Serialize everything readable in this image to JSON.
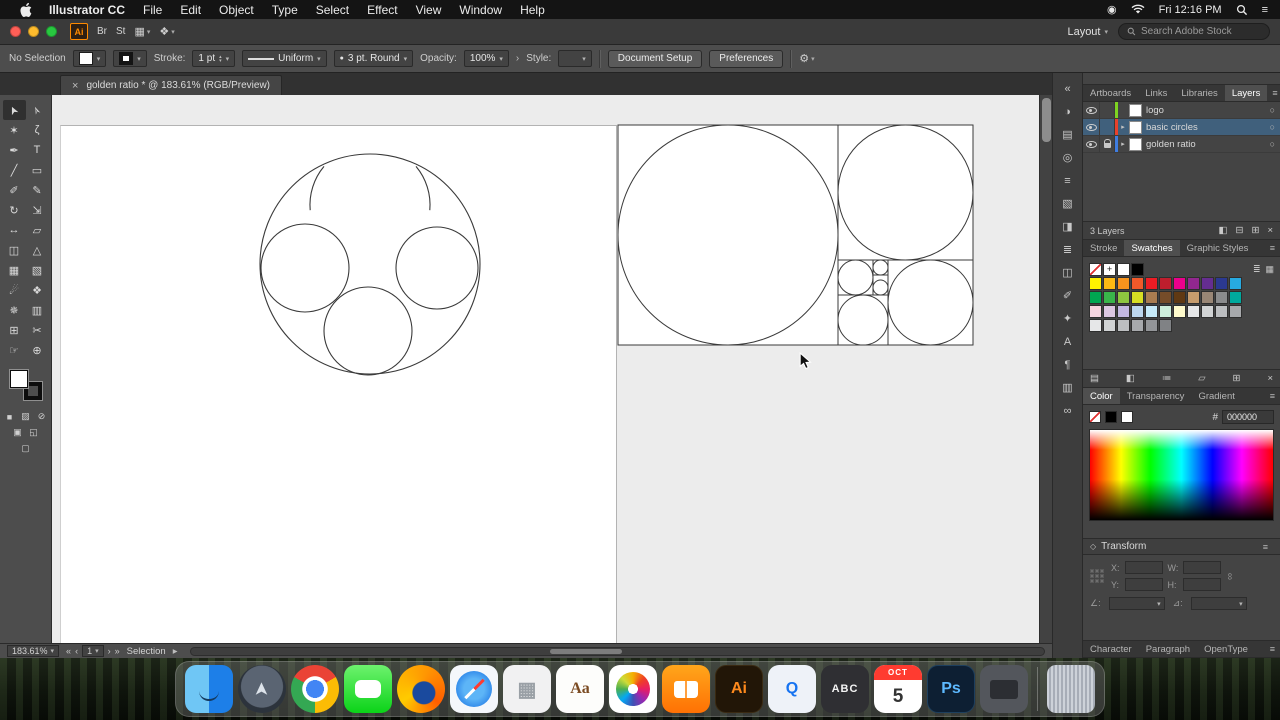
{
  "menubar": {
    "app_name": "Illustrator CC",
    "items": [
      "File",
      "Edit",
      "Object",
      "Type",
      "Select",
      "Effect",
      "View",
      "Window",
      "Help"
    ],
    "clock": "Fri 12:16 PM"
  },
  "appbar": {
    "ai_badge": "Ai",
    "bridge": "Br",
    "stock": "St",
    "layout_label": "Layout",
    "search_placeholder": "Search Adobe Stock"
  },
  "controlbar": {
    "selection_label": "No Selection",
    "stroke_label": "Stroke:",
    "stroke_value": "1 pt",
    "profile_value": "Uniform",
    "brush_value": "3 pt. Round",
    "opacity_label": "Opacity:",
    "opacity_value": "100%",
    "style_label": "Style:",
    "document_setup": "Document Setup",
    "preferences": "Preferences"
  },
  "document_tab": {
    "close": "×",
    "title": "golden ratio * @ 183.61% (RGB/Preview)"
  },
  "tools": [
    {
      "name": "selection-tool",
      "glyph": "➤",
      "active": true
    },
    {
      "name": "direct-selection-tool",
      "glyph": "➢"
    },
    {
      "name": "magic-wand-tool",
      "glyph": "✶"
    },
    {
      "name": "lasso-tool",
      "glyph": "ζ"
    },
    {
      "name": "pen-tool",
      "glyph": "✒"
    },
    {
      "name": "type-tool",
      "glyph": "T"
    },
    {
      "name": "line-segment-tool",
      "glyph": "╱"
    },
    {
      "name": "rectangle-tool",
      "glyph": "▭"
    },
    {
      "name": "paintbrush-tool",
      "glyph": "✐"
    },
    {
      "name": "pencil-tool",
      "glyph": "✎"
    },
    {
      "name": "rotate-tool",
      "glyph": "↻"
    },
    {
      "name": "scale-tool",
      "glyph": "⇲"
    },
    {
      "name": "width-tool",
      "glyph": "↔"
    },
    {
      "name": "free-transform-tool",
      "glyph": "▱"
    },
    {
      "name": "shape-builder-tool",
      "glyph": "◫"
    },
    {
      "name": "perspective-grid-tool",
      "glyph": "△"
    },
    {
      "name": "mesh-tool",
      "glyph": "▦"
    },
    {
      "name": "gradient-tool",
      "glyph": "▧"
    },
    {
      "name": "eyedropper-tool",
      "glyph": "☄"
    },
    {
      "name": "blend-tool",
      "glyph": "❖"
    },
    {
      "name": "symbol-sprayer-tool",
      "glyph": "✵"
    },
    {
      "name": "column-graph-tool",
      "glyph": "▥"
    },
    {
      "name": "artboard-tool",
      "glyph": "⊞"
    },
    {
      "name": "slice-tool",
      "glyph": "✂"
    },
    {
      "name": "hand-tool",
      "glyph": "☞"
    },
    {
      "name": "zoom-tool",
      "glyph": "⊕"
    }
  ],
  "statusbar": {
    "zoom": "183.61%",
    "artboard": "1",
    "status": "Selection"
  },
  "right_strip": {
    "icons": [
      {
        "name": "expand-panels-icon",
        "glyph": "«"
      },
      {
        "name": "color-panel-icon",
        "glyph": "◑"
      },
      {
        "name": "color-guide-panel-icon",
        "glyph": "▤"
      },
      {
        "name": "appearance-panel-icon",
        "glyph": "◎"
      },
      {
        "name": "stroke-panel-icon",
        "glyph": "≡"
      },
      {
        "name": "gradient-panel-icon",
        "glyph": "▧"
      },
      {
        "name": "transparency-panel-icon",
        "glyph": "◨"
      },
      {
        "name": "align-panel-icon",
        "glyph": "≣"
      },
      {
        "name": "pathfinder-panel-icon",
        "glyph": "◫"
      },
      {
        "name": "brushes-panel-icon",
        "glyph": "✐"
      },
      {
        "name": "symbols-panel-icon",
        "glyph": "✦"
      },
      {
        "name": "character-panel-icon",
        "glyph": "A"
      },
      {
        "name": "paragraph-panel-icon",
        "glyph": "¶"
      },
      {
        "name": "libraries-panel-icon",
        "glyph": "▥"
      },
      {
        "name": "links-panel-icon",
        "glyph": "∞"
      }
    ]
  },
  "panels": {
    "top_tabs": [
      "Artboards",
      "Links",
      "Libraries",
      "Layers"
    ],
    "top_active": "Layers",
    "layers": [
      {
        "name": "logo",
        "color": "#7ed321",
        "expander": false,
        "locked": false,
        "selected": false
      },
      {
        "name": "basic circles",
        "color": "#e8412c",
        "expander": true,
        "locked": false,
        "selected": true
      },
      {
        "name": "golden ratio",
        "color": "#3f7de0",
        "expander": true,
        "locked": true,
        "selected": false
      }
    ],
    "layers_count": "3 Layers",
    "layers_icons": [
      {
        "name": "make-clip-mask-icon",
        "glyph": "◧"
      },
      {
        "name": "new-sublayer-icon",
        "glyph": "⊟"
      },
      {
        "name": "new-layer-icon",
        "glyph": "⊞"
      },
      {
        "name": "delete-layer-icon",
        "glyph": "×"
      }
    ],
    "swatch_tabs": [
      "Stroke",
      "Swatches",
      "Graphic Styles"
    ],
    "swatch_active": "Swatches",
    "swatches": {
      "row1": [
        "none",
        "registration",
        "#ffffff",
        "#000000"
      ],
      "rows": [
        [
          "#fff200",
          "#fdb913",
          "#f7941d",
          "#f1592a",
          "#ed1c24",
          "#be1e2d",
          "#ec008c",
          "#92278f",
          "#652d90",
          "#2b3990",
          "#27aae1"
        ],
        [
          "#00a651",
          "#39b54a",
          "#8dc63f",
          "#d7df23",
          "#a97c50",
          "#754c29",
          "#603913",
          "#c69c6d",
          "#998675",
          "#8b8c8d",
          "#00a99d"
        ],
        [
          "#f5d5e0",
          "#dcc7e1",
          "#c3b8e0",
          "#bdd7ee",
          "#c6eaf8",
          "#cdeedb",
          "#fffbcc",
          "#e6e7e8",
          "#d1d3d4",
          "#bcbec0",
          "#a7a9ac"
        ],
        [
          "#e6e7e8",
          "#d1d3d4",
          "#bcbec0",
          "#a7a9ac",
          "#939598",
          "#808285"
        ]
      ]
    },
    "swatch_view_icons": [
      {
        "name": "swatch-list-view-icon",
        "glyph": "≣"
      },
      {
        "name": "swatch-grid-view-icon",
        "glyph": "▦"
      }
    ],
    "swatch_icons": [
      {
        "name": "swatch-libraries-icon",
        "glyph": "▤"
      },
      {
        "name": "swatch-kinds-icon",
        "glyph": "◧"
      },
      {
        "name": "swatch-options-icon",
        "glyph": "≔"
      },
      {
        "name": "new-color-group-icon",
        "glyph": "▱"
      },
      {
        "name": "new-swatch-icon",
        "glyph": "⊞"
      },
      {
        "name": "delete-swatch-icon",
        "glyph": "×"
      }
    ],
    "color_tabs": [
      "Color",
      "Transparency",
      "Gradient"
    ],
    "color_active": "Color",
    "hex_label": "#",
    "hex_value": "000000",
    "transform": {
      "title": "Transform",
      "fields": [
        "X:",
        "W:",
        "Y:",
        "H:"
      ],
      "angle_label": "∠:",
      "shear_label": "⊿:"
    },
    "type_tabs": [
      "Character",
      "Paragraph",
      "OpenType"
    ]
  },
  "dock": [
    {
      "name": "finder"
    },
    {
      "name": "launchpad"
    },
    {
      "name": "chrome"
    },
    {
      "name": "messages"
    },
    {
      "name": "firefox"
    },
    {
      "name": "safari"
    },
    {
      "name": "utility-grid",
      "label": "▦"
    },
    {
      "name": "dictionary",
      "label": "Aa"
    },
    {
      "name": "photos"
    },
    {
      "name": "ibooks"
    },
    {
      "name": "illustrator",
      "label": "Ai"
    },
    {
      "name": "quicktime",
      "label": "Q"
    },
    {
      "name": "abc-book",
      "label": "ABC"
    },
    {
      "name": "calendar",
      "month": "OCT",
      "day": "5"
    },
    {
      "name": "photoshop",
      "label": "Ps"
    },
    {
      "name": "dark-app"
    },
    {
      "name": "trash"
    }
  ]
}
